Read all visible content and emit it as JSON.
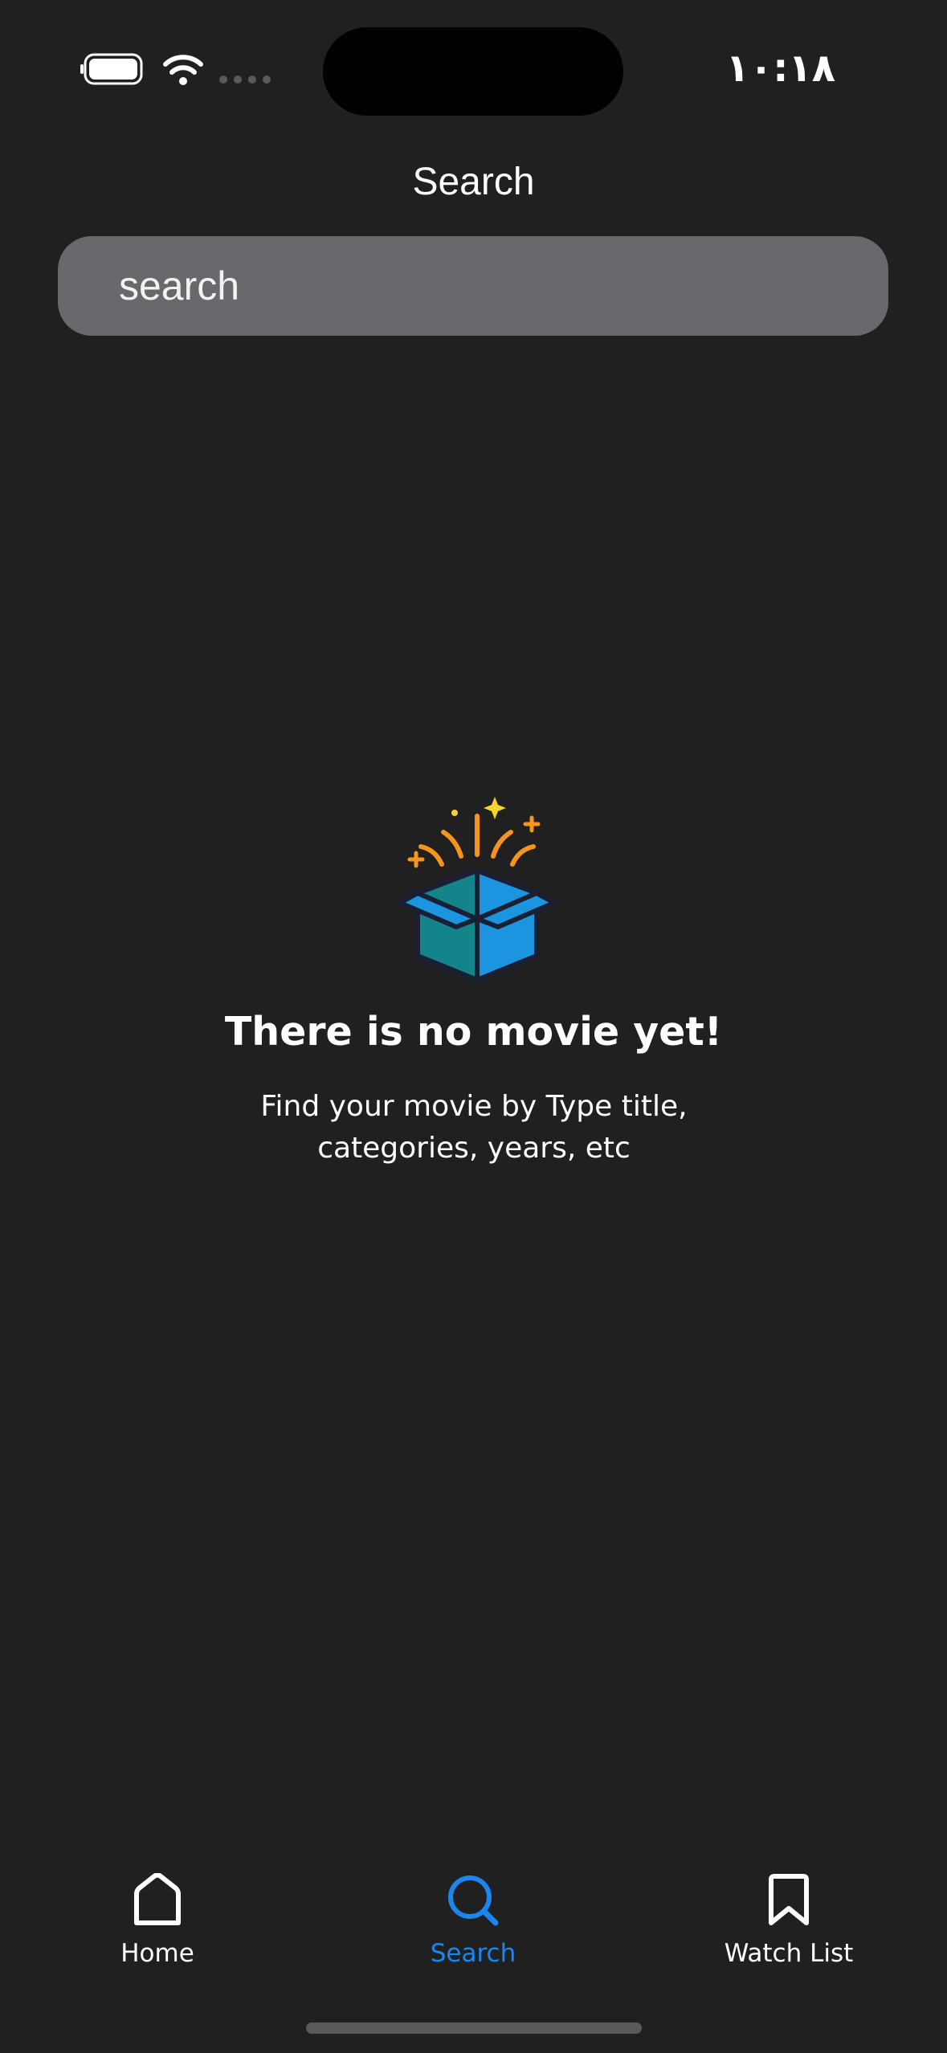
{
  "status_bar": {
    "time": "١٠:١٨",
    "battery_icon": "battery-icon",
    "wifi_icon": "wifi-icon",
    "signal_icon": "cellular-signal-icon"
  },
  "header": {
    "title": "Search"
  },
  "search": {
    "placeholder": "search",
    "value": ""
  },
  "empty_state": {
    "icon": "open-box-icon",
    "title": "There is no movie yet!",
    "description": "Find your movie by Type title, categories, years, etc"
  },
  "tab_bar": {
    "active_color": "#1b86f2",
    "tabs": [
      {
        "label": "Home",
        "icon": "home-icon",
        "active": false
      },
      {
        "label": "Search",
        "icon": "search-icon",
        "active": true
      },
      {
        "label": "Watch List",
        "icon": "bookmark-icon",
        "active": false
      }
    ]
  }
}
